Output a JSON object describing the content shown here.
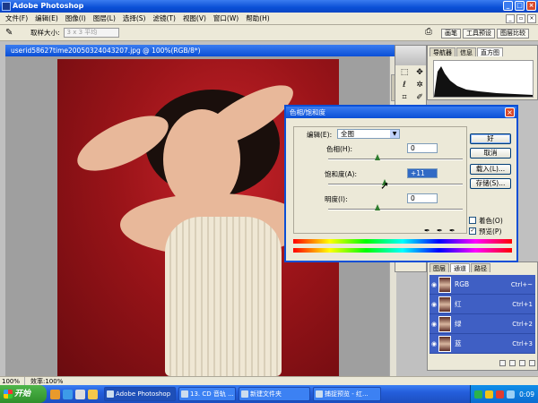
{
  "window": {
    "title": "Adobe Photoshop"
  },
  "menu": {
    "items": [
      "文件(F)",
      "编辑(E)",
      "图像(I)",
      "图层(L)",
      "选择(S)",
      "滤镜(T)",
      "视图(V)",
      "窗口(W)",
      "帮助(H)"
    ]
  },
  "options": {
    "sample_label": "取样大小:",
    "sample_value": "3 x 3 平均",
    "well_tabs": [
      "画笔",
      "工具预设",
      "图层比较"
    ]
  },
  "document": {
    "title": "userid58627time20050324043207.jpg @ 100%(RGB/8*)"
  },
  "info_palette": {
    "tabs": [
      "导航器",
      "信息",
      "直方图"
    ]
  },
  "channels_palette": {
    "tabs": [
      "图层",
      "通道",
      "路径"
    ],
    "channels": [
      {
        "name": "RGB",
        "shortcut": "Ctrl+~"
      },
      {
        "name": "红",
        "shortcut": "Ctrl+1"
      },
      {
        "name": "绿",
        "shortcut": "Ctrl+2"
      },
      {
        "name": "蓝",
        "shortcut": "Ctrl+3"
      }
    ]
  },
  "hue_saturation": {
    "title": "色相/饱和度",
    "edit_label": "编辑(E):",
    "edit_value": "全图",
    "hue_label": "色相(H):",
    "hue_value": "0",
    "saturation_label": "饱和度(A):",
    "saturation_value": "+11",
    "lightness_label": "明度(I):",
    "lightness_value": "0",
    "buttons": {
      "ok": "好",
      "cancel": "取消",
      "load": "载入(L)...",
      "save": "存储(S)..."
    },
    "colorize_label": "着色(O)",
    "preview_label": "预览(P)",
    "preview_checked": "✓"
  },
  "status": {
    "zoom": "100%",
    "efficiency": "效率:100%"
  },
  "taskbar": {
    "start": "开始",
    "tasks": [
      "Adobe Photoshop",
      "13. CD 音轨 ...",
      "新建文件夹",
      "捕捉预览 - 红..."
    ],
    "clock": "0:09"
  },
  "colors": {
    "titlebar": "#0a4fd6",
    "canvas_background": "#9b1419",
    "channel_selected": "#3f5fc4",
    "taskbar": "#245edb"
  }
}
